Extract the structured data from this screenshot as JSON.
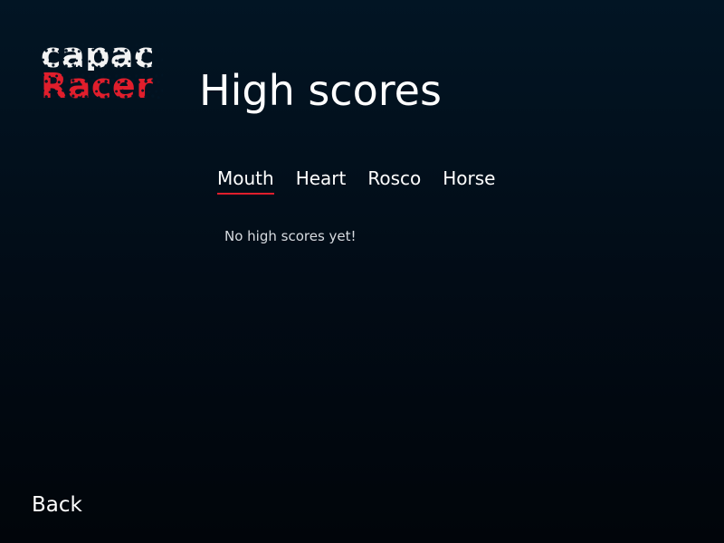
{
  "logo": {
    "line1": "capac",
    "line2": "Racer"
  },
  "header": {
    "title": "High scores"
  },
  "tabs": [
    {
      "label": "Mouth",
      "active": true
    },
    {
      "label": "Heart",
      "active": false
    },
    {
      "label": "Rosco",
      "active": false
    },
    {
      "label": "Horse",
      "active": false
    }
  ],
  "main": {
    "empty_message": "No high scores yet!"
  },
  "footer": {
    "back_label": "Back"
  },
  "colors": {
    "accent": "#e01e2c",
    "background": "#021524",
    "text": "#ffffff"
  }
}
